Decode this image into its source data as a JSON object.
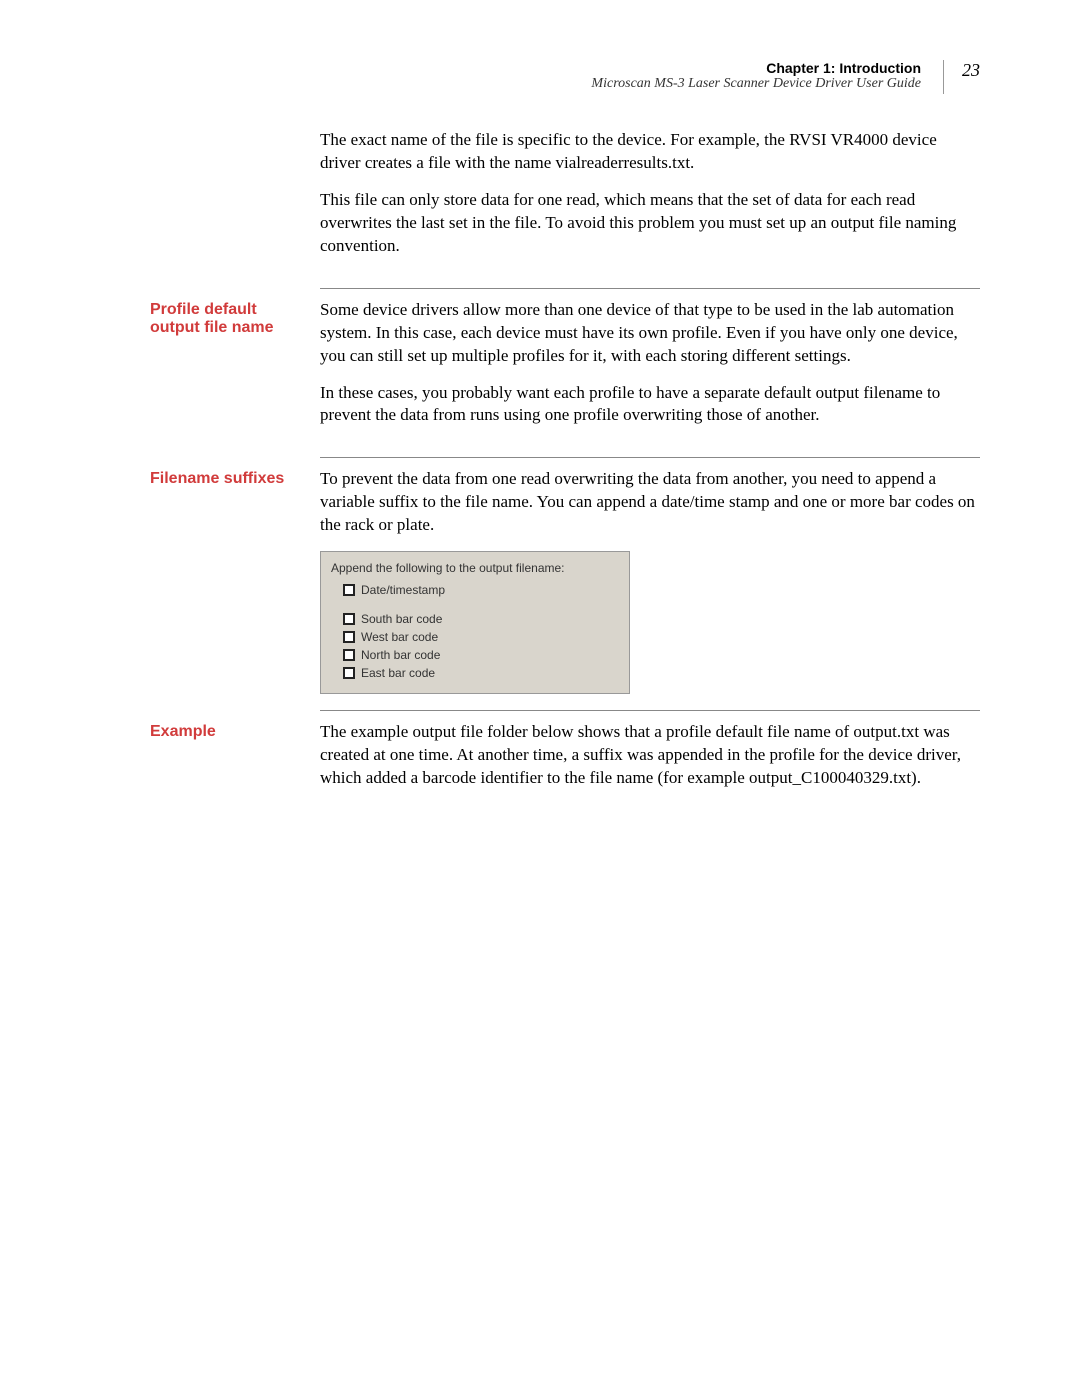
{
  "header": {
    "chapter": "Chapter 1: Introduction",
    "doc_title": "Microscan MS-3 Laser Scanner Device Driver User Guide",
    "page_number": "23"
  },
  "intro": {
    "p1": "The exact name of the file is specific to the device. For example, the RVSI VR4000 device driver creates a file with the name vialreaderresults.txt.",
    "p2": "This file can only store data for one read, which means that the set of data for each read overwrites the last set in the file. To avoid this problem you must set up an output file naming convention."
  },
  "profile_default": {
    "label": "Profile default output file name",
    "p1": "Some device drivers allow more than one device of that type to be used in the lab automation system. In this case, each device must have its own profile. Even if you have only one device, you can still set up multiple profiles for it, with each storing different settings.",
    "p2": "In these cases, you probably want each profile to have a separate default output filename to prevent the data from runs using one profile overwriting those of another."
  },
  "filename_suffixes": {
    "label": "Filename suffixes",
    "p1": "To prevent the data from one read overwriting the data from another, you need to append a variable suffix to the file name. You can append a date/time stamp and one or more bar codes on the rack or plate.",
    "box_title": "Append the following to the output filename:",
    "options": [
      "Date/timestamp",
      "South bar code",
      "West bar code",
      "North bar code",
      "East bar code"
    ]
  },
  "example": {
    "label": "Example",
    "p1": "The example output file folder below shows that a profile default file name of output.txt was created at one time. At another time, a suffix was appended in the profile for the device driver, which added a barcode identifier to the file name (for example output_C100040329.txt)."
  }
}
